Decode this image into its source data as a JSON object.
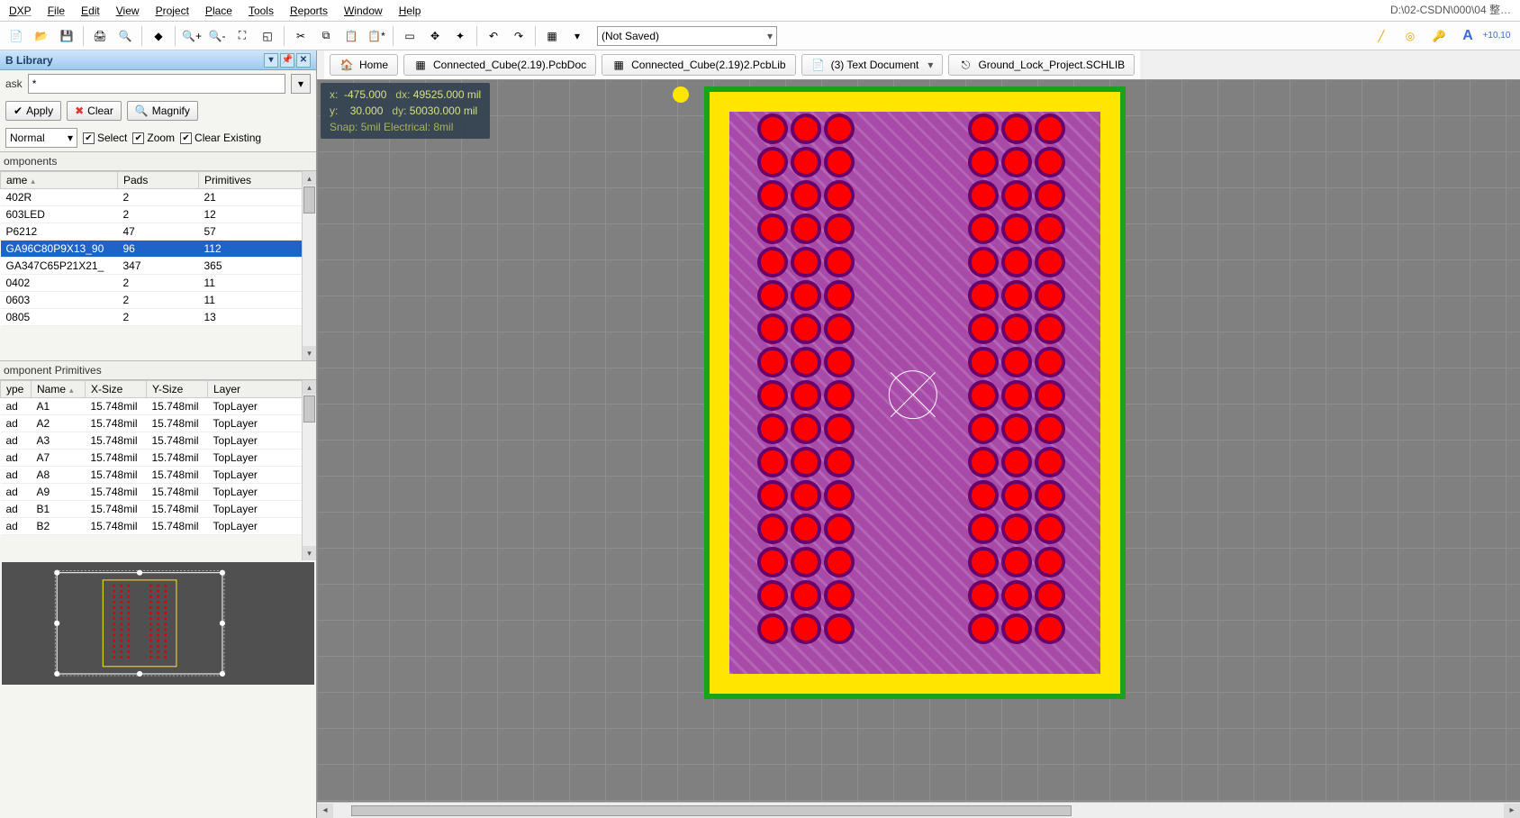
{
  "menubar": [
    "DXP",
    "File",
    "Edit",
    "View",
    "Project",
    "Place",
    "Tools",
    "Reports",
    "Window",
    "Help"
  ],
  "path_hint": "D:\\02-CSDN\\000\\04 整…",
  "toolbar": {
    "combo_value": "(Not Saved)"
  },
  "doc_tabs": [
    {
      "icon": "home-icon",
      "label": "Home",
      "dd": false
    },
    {
      "icon": "pcb-icon",
      "label": "Connected_Cube(2.19).PcbDoc",
      "dd": false
    },
    {
      "icon": "pcblib-icon",
      "label": "Connected_Cube(2.19)2.PcbLib",
      "dd": false
    },
    {
      "icon": "text-icon",
      "label": "(3) Text Document",
      "dd": true
    },
    {
      "icon": "sch-icon",
      "label": "Ground_Lock_Project.SCHLIB",
      "dd": false
    }
  ],
  "panel": {
    "title": "B Library",
    "mask_label": "ask",
    "mask_value": "*",
    "apply": "Apply",
    "clear": "Clear",
    "magnify": "Magnify",
    "mode": "Normal",
    "select": "Select",
    "zoom": "Zoom",
    "clear_existing": "Clear Existing",
    "sections": {
      "components": "omponents",
      "primitives": "omponent Primitives"
    },
    "comp_cols": [
      "ame",
      "Pads",
      "Primitives"
    ],
    "components": [
      {
        "name": "402R",
        "pads": "2",
        "prim": "21",
        "sel": false
      },
      {
        "name": "603LED",
        "pads": "2",
        "prim": "12",
        "sel": false
      },
      {
        "name": "P6212",
        "pads": "47",
        "prim": "57",
        "sel": false
      },
      {
        "name": "GA96C80P9X13_90",
        "pads": "96",
        "prim": "112",
        "sel": true
      },
      {
        "name": "GA347C65P21X21_",
        "pads": "347",
        "prim": "365",
        "sel": false
      },
      {
        "name": "0402",
        "pads": "2",
        "prim": "11",
        "sel": false
      },
      {
        "name": "0603",
        "pads": "2",
        "prim": "11",
        "sel": false
      },
      {
        "name": "0805",
        "pads": "2",
        "prim": "13",
        "sel": false
      }
    ],
    "prim_cols": [
      "ype",
      "Name",
      "X-Size",
      "Y-Size",
      "Layer"
    ],
    "primitives": [
      {
        "t": "ad",
        "n": "A1",
        "x": "15.748mil",
        "y": "15.748mil",
        "l": "TopLayer"
      },
      {
        "t": "ad",
        "n": "A2",
        "x": "15.748mil",
        "y": "15.748mil",
        "l": "TopLayer"
      },
      {
        "t": "ad",
        "n": "A3",
        "x": "15.748mil",
        "y": "15.748mil",
        "l": "TopLayer"
      },
      {
        "t": "ad",
        "n": "A7",
        "x": "15.748mil",
        "y": "15.748mil",
        "l": "TopLayer"
      },
      {
        "t": "ad",
        "n": "A8",
        "x": "15.748mil",
        "y": "15.748mil",
        "l": "TopLayer"
      },
      {
        "t": "ad",
        "n": "A9",
        "x": "15.748mil",
        "y": "15.748mil",
        "l": "TopLayer"
      },
      {
        "t": "ad",
        "n": "B1",
        "x": "15.748mil",
        "y": "15.748mil",
        "l": "TopLayer"
      },
      {
        "t": "ad",
        "n": "B2",
        "x": "15.748mil",
        "y": "15.748mil",
        "l": "TopLayer"
      }
    ]
  },
  "overlay": {
    "x_label": "x:",
    "x_val": "-475.000",
    "dx_label": "dx:",
    "dx_val": "49525.000 mil",
    "y_label": "y:",
    "y_val": "30.000",
    "dy_label": "dy:",
    "dy_val": "50030.000 mil",
    "snap": "Snap: 5mil Electrical: 8mil"
  },
  "pad_cols": [
    59,
    96,
    133,
    293,
    330,
    367
  ],
  "pad_rows": 16
}
